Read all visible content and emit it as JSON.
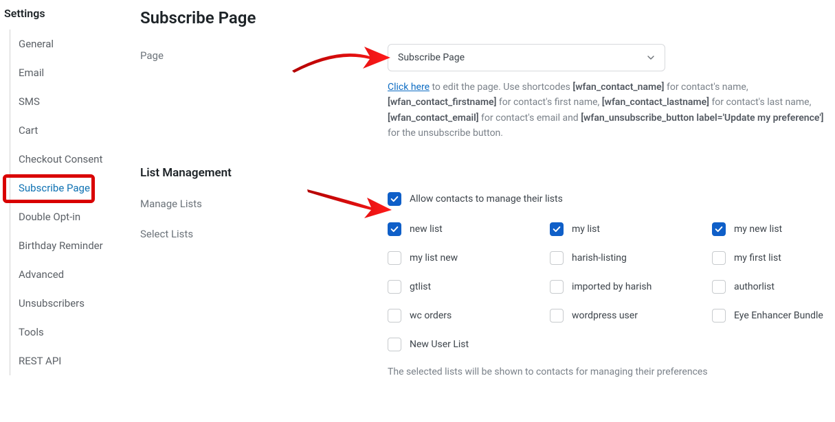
{
  "sidebar": {
    "title": "Settings",
    "items": [
      {
        "label": "General"
      },
      {
        "label": "Email"
      },
      {
        "label": "SMS"
      },
      {
        "label": "Cart"
      },
      {
        "label": "Checkout Consent"
      },
      {
        "label": "Subscribe Page",
        "active": true
      },
      {
        "label": "Double Opt-in"
      },
      {
        "label": "Birthday Reminder"
      },
      {
        "label": "Advanced"
      },
      {
        "label": "Unsubscribers"
      },
      {
        "label": "Tools"
      },
      {
        "label": "REST API"
      }
    ]
  },
  "page": {
    "title": "Subscribe Page",
    "page_label": "Page",
    "select_value": "Subscribe Page",
    "help_link": "Click here",
    "help_text_1": " to edit the page. Use shortcodes ",
    "sc1": "[wfan_contact_name]",
    "help_text_2": " for contact's name, ",
    "sc2": "[wfan_contact_firstname]",
    "help_text_3": " for contact's first name, ",
    "sc3": "[wfan_contact_lastname]",
    "help_text_4": " for contact's last name, ",
    "sc4": "[wfan_contact_email]",
    "help_text_5": " for contact's email and ",
    "sc5": "[wfan_unsubscribe_button label='Update my preference']",
    "help_text_6": " for the unsubscribe button."
  },
  "list_mgmt": {
    "heading": "List Management",
    "manage_label": "Manage Lists",
    "manage_cb_label": "Allow contacts to manage their lists",
    "select_label": "Select Lists",
    "lists": [
      [
        {
          "label": "new list",
          "checked": true
        },
        {
          "label": "my list",
          "checked": true
        },
        {
          "label": "my new list",
          "checked": true
        }
      ],
      [
        {
          "label": "my list new",
          "checked": false
        },
        {
          "label": "harish-listing",
          "checked": false
        },
        {
          "label": "my first list",
          "checked": false
        }
      ],
      [
        {
          "label": "gtlist",
          "checked": false
        },
        {
          "label": "imported by harish",
          "checked": false
        },
        {
          "label": "authorlist",
          "checked": false
        }
      ],
      [
        {
          "label": "wc orders",
          "checked": false
        },
        {
          "label": "wordpress user",
          "checked": false
        },
        {
          "label": "Eye Enhancer Bundle",
          "checked": false
        }
      ],
      [
        {
          "label": "New User List",
          "checked": false
        }
      ]
    ],
    "note": "The selected lists will be shown to contacts for managing their preferences"
  }
}
